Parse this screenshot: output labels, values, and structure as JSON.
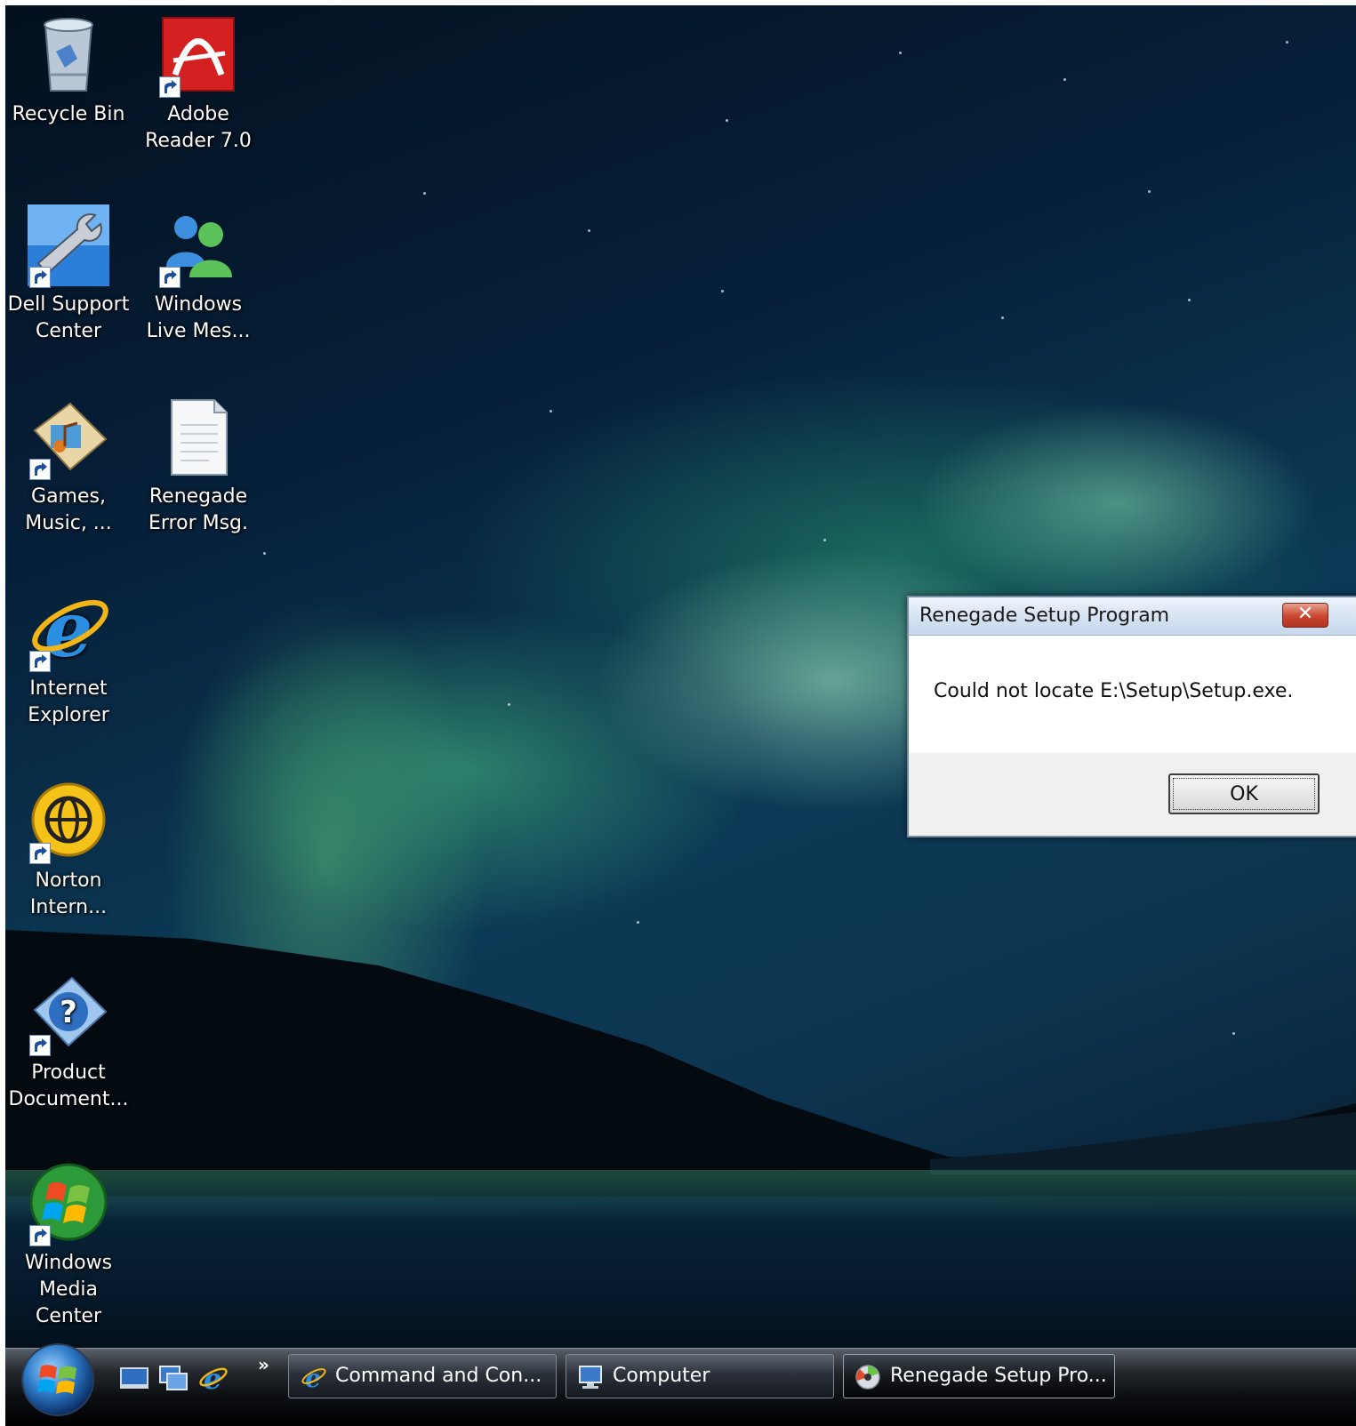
{
  "desktop": {
    "icons": [
      {
        "label": "Recycle Bin",
        "icon": "recycle-bin-icon"
      },
      {
        "label": "Adobe Reader 7.0",
        "icon": "adobe-reader-icon"
      },
      {
        "label": "Dell Support Center",
        "icon": "dell-support-icon"
      },
      {
        "label": "Windows Live Mes...",
        "icon": "windows-live-messenger-icon"
      },
      {
        "label": "Games, Music, ...",
        "icon": "games-music-icon"
      },
      {
        "label": "Renegade Error Msg.",
        "icon": "text-document-icon"
      },
      {
        "label": "Internet Explorer",
        "icon": "internet-explorer-icon"
      },
      {
        "label": "Norton Intern...",
        "icon": "norton-icon"
      },
      {
        "label": "Product Document...",
        "icon": "help-document-icon"
      },
      {
        "label": "Windows Media Center",
        "icon": "windows-media-center-icon"
      }
    ]
  },
  "dialog": {
    "title": "Renegade Setup Program",
    "close_label": "✕",
    "message": "Could not locate E:\\Setup\\Setup.exe.",
    "ok_label": "OK"
  },
  "taskbar": {
    "overflow_label": "»",
    "buttons": [
      {
        "label": "Command and Con...",
        "icon": "internet-explorer-icon"
      },
      {
        "label": "Computer",
        "icon": "computer-icon"
      },
      {
        "label": "Renegade Setup Pro...",
        "icon": "cd-disc-icon"
      }
    ]
  },
  "colors": {
    "dialog_title_bg": "#d3e1f1",
    "close_button": "#c9452f",
    "taskbar": "#0d1013"
  }
}
